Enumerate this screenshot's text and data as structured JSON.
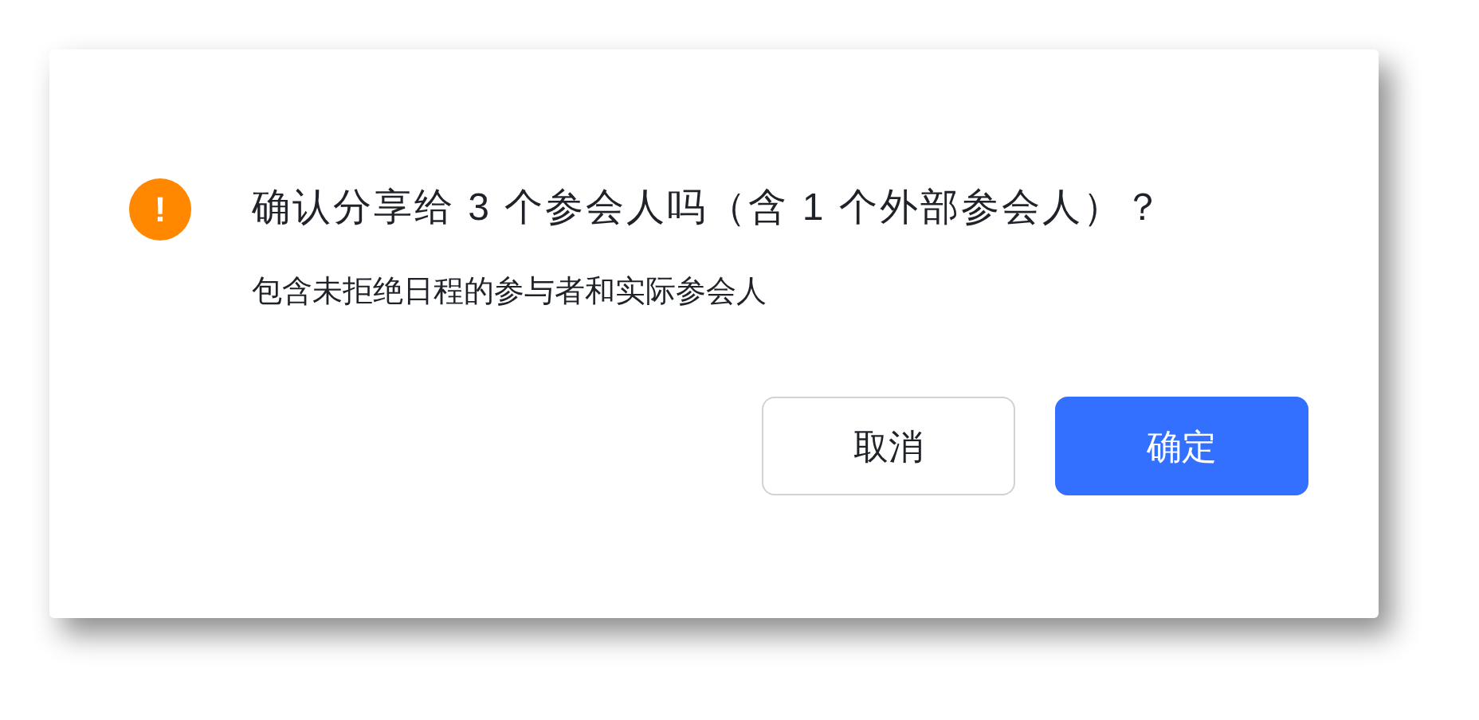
{
  "dialog": {
    "icon": "!",
    "title": "确认分享给 3 个参会人吗（含 1 个外部参会人）？",
    "description": "包含未拒绝日程的参与者和实际参会人",
    "buttons": [
      {
        "label": "取消",
        "kind": "secondary"
      },
      {
        "label": "确定",
        "kind": "primary"
      }
    ]
  }
}
